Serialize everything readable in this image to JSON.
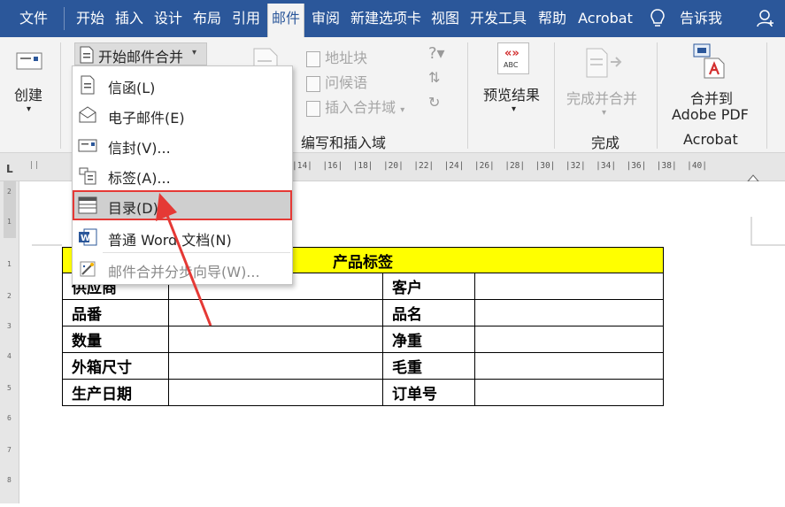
{
  "tabs": [
    {
      "label": "文件"
    },
    {
      "label": "开始"
    },
    {
      "label": "插入"
    },
    {
      "label": "设计"
    },
    {
      "label": "布局"
    },
    {
      "label": "引用"
    },
    {
      "label": "邮件"
    },
    {
      "label": "审阅"
    },
    {
      "label": "新建选项卡"
    },
    {
      "label": "视图"
    },
    {
      "label": "开发工具"
    },
    {
      "label": "帮助"
    },
    {
      "label": "Acrobat"
    }
  ],
  "tell_me": "告诉我",
  "ribbon": {
    "create": "创建",
    "start_merge": "开始邮件合并",
    "address_block": "地址块",
    "greeting_line": "问候语",
    "insert_merge_field": "插入合并域",
    "write_insert_group": "编写和插入域",
    "preview_results": "预览结果",
    "finish_merge": "完成并合并",
    "finish_group": "完成",
    "merge_to_pdf_line1": "合并到",
    "merge_to_pdf_line2": "Adobe PDF",
    "acrobat_group": "Acrobat",
    "abc_icon_text": "ABC"
  },
  "ruler": {
    "numbers": "|14|  |16|  |18|  |20|  |22|  |24|  |26|  |28|  |30|  |32|  |34|  |36|  |38|  |40|"
  },
  "menu": {
    "items": [
      {
        "label": "信函(L)"
      },
      {
        "label": "电子邮件(E)"
      },
      {
        "label": "信封(V)..."
      },
      {
        "label": "标签(A)..."
      },
      {
        "label": "目录(D)"
      },
      {
        "label": "普通 Word 文档(N)"
      },
      {
        "label": "邮件合并分步向导(W)..."
      }
    ]
  },
  "table": {
    "title": "产品标签",
    "rows": [
      {
        "left": "供应商",
        "right": "客户"
      },
      {
        "left": "品番",
        "right": "品名"
      },
      {
        "left": "数量",
        "right": "净重"
      },
      {
        "left": "外箱尺寸",
        "right": "毛重"
      },
      {
        "left": "生产日期",
        "right": "订单号"
      }
    ]
  },
  "colors": {
    "tabbar": "#2b579a",
    "table_header": "#ffff00",
    "highlight_box": "#e53935",
    "arrow": "#e53935"
  }
}
